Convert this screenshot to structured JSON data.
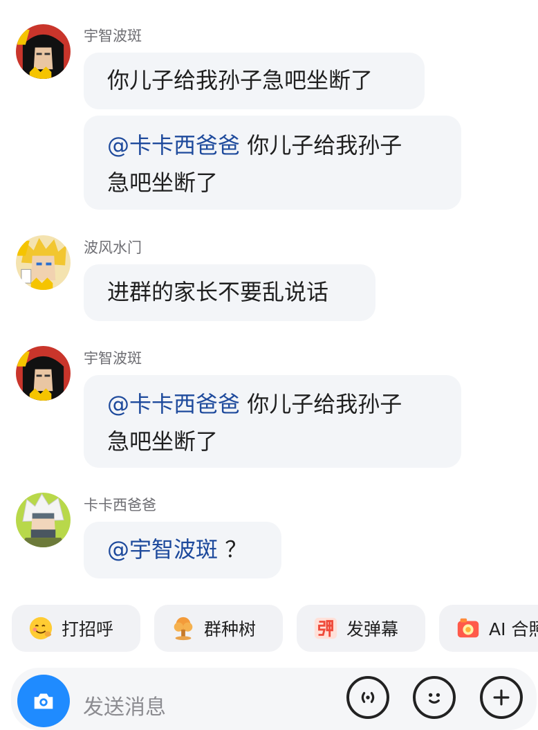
{
  "chat": {
    "messages": [
      {
        "sender": "宇智波斑",
        "avatar_icon": "madara-avatar-icon",
        "bubbles": [
          {
            "lines": [
              {
                "mention": "",
                "text": "你儿子给我孙子急吧坐断了"
              }
            ]
          },
          {
            "lines": [
              {
                "mention": "@卡卡西爸爸",
                "text": " 你儿子给我孙子"
              },
              {
                "mention": "",
                "text": "急吧坐断了"
              }
            ]
          }
        ]
      },
      {
        "sender": "波风水门",
        "avatar_icon": "minato-avatar-icon",
        "bubbles": [
          {
            "lines": [
              {
                "mention": "",
                "text": "进群的家长不要乱说话"
              }
            ]
          }
        ]
      },
      {
        "sender": "宇智波斑",
        "avatar_icon": "madara-avatar-icon",
        "bubbles": [
          {
            "lines": [
              {
                "mention": "@卡卡西爸爸",
                "text": " 你儿子给我孙子"
              },
              {
                "mention": "",
                "text": "急吧坐断了"
              }
            ]
          }
        ]
      },
      {
        "sender": "卡卡西爸爸",
        "avatar_icon": "kakashi-avatar-icon",
        "bubbles": [
          {
            "lines": [
              {
                "mention": "@宇智波斑",
                "text": " ？"
              }
            ]
          }
        ]
      }
    ]
  },
  "quick_actions": [
    {
      "label": "打招呼",
      "icon": "wave-emoji-icon"
    },
    {
      "label": "群种树",
      "icon": "tree-icon"
    },
    {
      "label": "发弹幕",
      "icon": "danmaku-icon"
    },
    {
      "label": "AI 合照",
      "icon": "camera-photo-icon"
    }
  ],
  "input": {
    "placeholder": "发送消息",
    "camera_icon": "camera-icon",
    "voice_icon": "voice-icon",
    "emoji_icon": "emoji-icon",
    "plus_icon": "plus-icon"
  },
  "colors": {
    "mention": "#1e4a9c",
    "bubble_bg": "#f3f5f8",
    "camera_button": "#1f8bff"
  }
}
